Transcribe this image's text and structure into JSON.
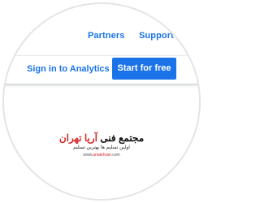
{
  "nav": {
    "partners_label": "Partners",
    "support_label": "Support"
  },
  "cta": {
    "signin_label": "Sign in to Analytics",
    "start_label": "Start for free"
  },
  "watermark": {
    "title_main": "مجتمع فنی ",
    "title_accent": "آریا تهران",
    "tagline": "اولین تسلیم ها بهترین تسلیم",
    "url_prefix": "www.",
    "url_domain": "ariatehran",
    "url_suffix": ".com"
  },
  "colors": {
    "accent_blue": "#1a73e8",
    "watermark_red": "#d42a2a"
  }
}
